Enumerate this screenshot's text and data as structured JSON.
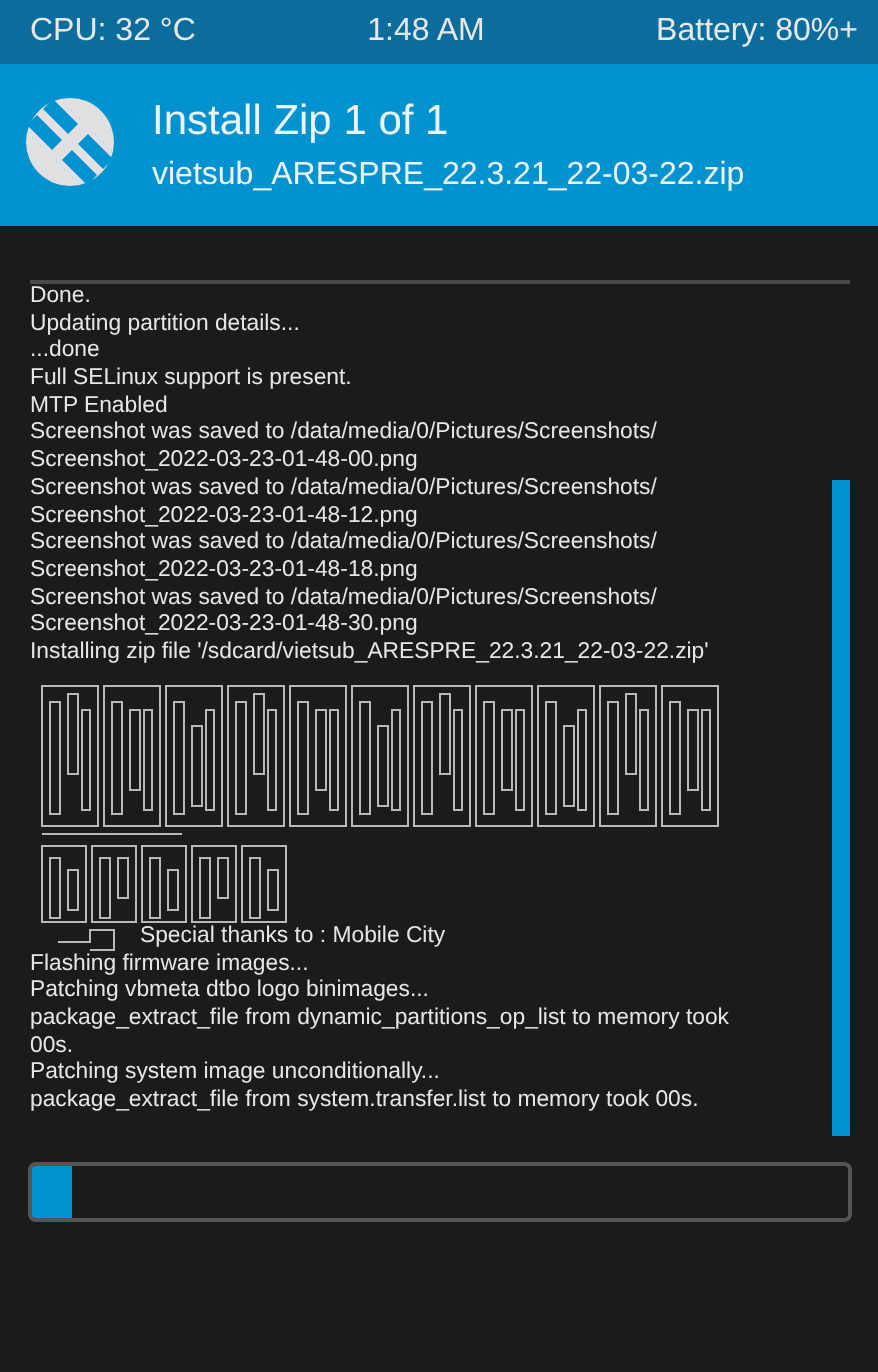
{
  "status_bar": {
    "cpu": "CPU: 32 °C",
    "time": "1:48 AM",
    "battery": "Battery: 80%+"
  },
  "header": {
    "title": "Install Zip 1 of 1",
    "subtitle": "vietsub_ARESPRE_22.3.21_22-03-22.zip"
  },
  "console": {
    "lines_before": [
      "Done.",
      "Updating partition details...",
      "...done",
      "Full SELinux support is present.",
      "MTP Enabled",
      "Screenshot was saved to /data/media/0/Pictures/Screenshots/",
      "Screenshot_2022-03-23-01-48-00.png",
      "Screenshot was saved to /data/media/0/Pictures/Screenshots/",
      "Screenshot_2022-03-23-01-48-12.png",
      "Screenshot was saved to /data/media/0/Pictures/Screenshots/",
      "Screenshot_2022-03-23-01-48-18.png",
      "Screenshot was saved to /data/media/0/Pictures/Screenshots/",
      "Screenshot_2022-03-23-01-48-30.png",
      "Installing zip file '/sdcard/vietsub_ARESPRE_22.3.21_22-03-22.zip'"
    ],
    "credits": "Special thanks to : Mobile City",
    "lines_after": [
      "Flashing firmware images...",
      "Patching vbmeta dtbo logo binimages...",
      "package_extract_file from dynamic_partitions_op_list to memory took",
      "00s.",
      "Patching system image unconditionally...",
      "package_extract_file from system.transfer.list to memory took 00s."
    ]
  },
  "progress": {
    "level": 0.05
  }
}
